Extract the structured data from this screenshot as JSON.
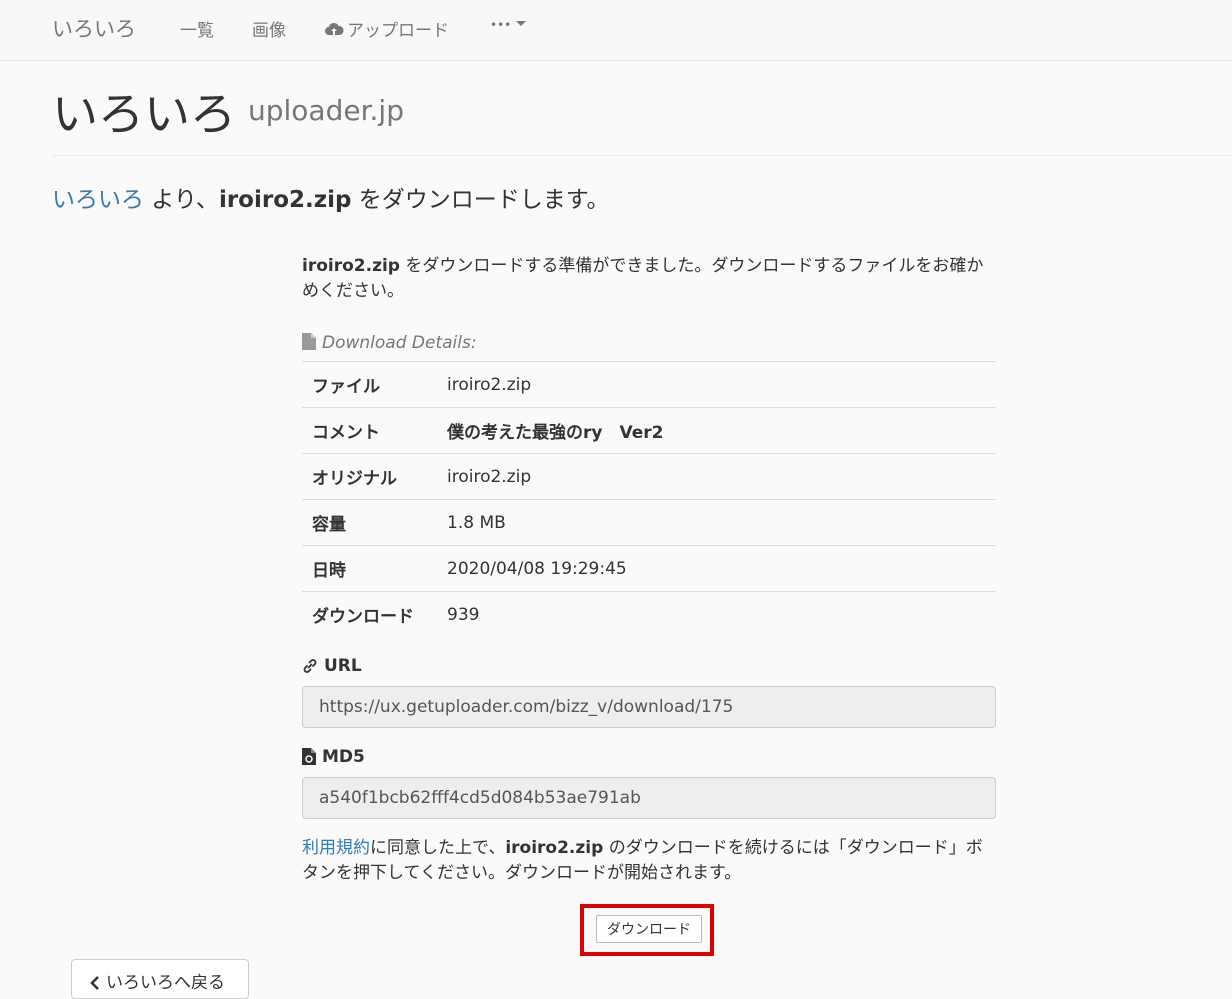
{
  "navbar": {
    "brand": "いろいろ",
    "links": [
      {
        "label": "一覧"
      },
      {
        "label": "画像"
      },
      {
        "label": "アップロード",
        "icon": "cloud-upload-icon"
      },
      {
        "label": "•••",
        "icon": "caret-down-icon"
      }
    ]
  },
  "header": {
    "title": "いろいろ",
    "subtitle": "uploader.jp"
  },
  "lead": {
    "user_link": "いろいろ",
    "text1": " より、",
    "filename": "iroiro2.zip",
    "text2": " をダウンロードします。"
  },
  "intro": {
    "filename": "iroiro2.zip",
    "text": " をダウンロードする準備ができました。ダウンロードするファイルをお確かめください。"
  },
  "details": {
    "heading": "Download Details:",
    "icon": "file-icon",
    "rows": [
      {
        "key": "ファイル",
        "value": "iroiro2.zip"
      },
      {
        "key": "コメント",
        "value": "僕の考えた最強のry　Ver2"
      },
      {
        "key": "オリジナル",
        "value": "iroiro2.zip"
      },
      {
        "key": "容量",
        "value": "1.8 MB"
      },
      {
        "key": "日時",
        "value": "2020/04/08 19:29:45"
      },
      {
        "key": "ダウンロード",
        "value": "939"
      }
    ]
  },
  "url": {
    "label": "URL",
    "icon": "link-icon",
    "value": "https://ux.getuploader.com/bizz_v/download/175"
  },
  "md5": {
    "label": "MD5",
    "icon": "file-hash-icon",
    "value": "a540f1bcb62fff4cd5d084b53ae791ab"
  },
  "terms": {
    "link": "利用規約",
    "text1": "に同意した上で、",
    "filename": "iroiro2.zip",
    "text2": " のダウンロードを続けるには「ダウンロード」ボタンを押下してください。ダウンロードが開始されます。"
  },
  "download_button": "ダウンロード",
  "back_button": "いろいろへ戻る",
  "colors": {
    "link": "#337ab7",
    "highlight": "#e00000"
  }
}
